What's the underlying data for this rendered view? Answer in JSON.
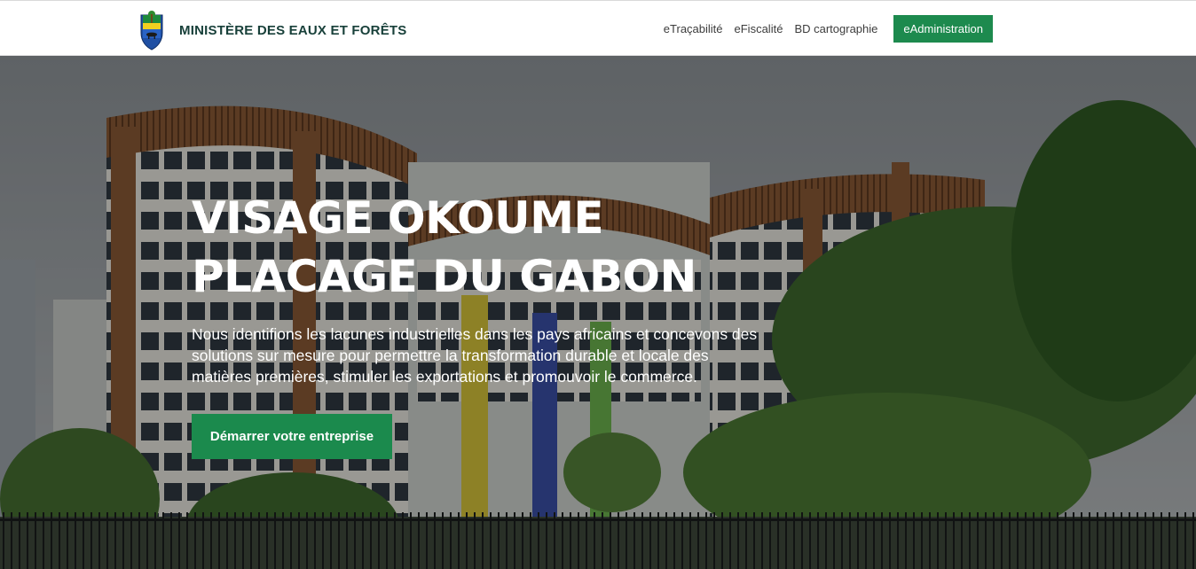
{
  "header": {
    "logo_icon": "gabon-coat-of-arms-icon",
    "ministry_name": "MINISTÈRE DES EAUX ET FORÊTS",
    "nav": [
      {
        "label": "eTraçabilité"
      },
      {
        "label": "eFiscalité"
      },
      {
        "label": "BD cartographie"
      }
    ],
    "cta_label": "eAdministration"
  },
  "hero": {
    "title_line1": "VISAGE OKOUME",
    "title_line2": "PLACAGE DU GABON",
    "description": "Nous identifions les lacunes industrielles dans les pays africains et concevons des solutions sur mesure pour permettre la transformation durable et locale des matières premières, stimuler les exportations et promouvoir le commerce.",
    "cta_label": "Démarrer votre entreprise",
    "background": "ministry-building-photo"
  },
  "colors": {
    "brand_green": "#1d8a4e",
    "brand_text": "#18403a"
  }
}
